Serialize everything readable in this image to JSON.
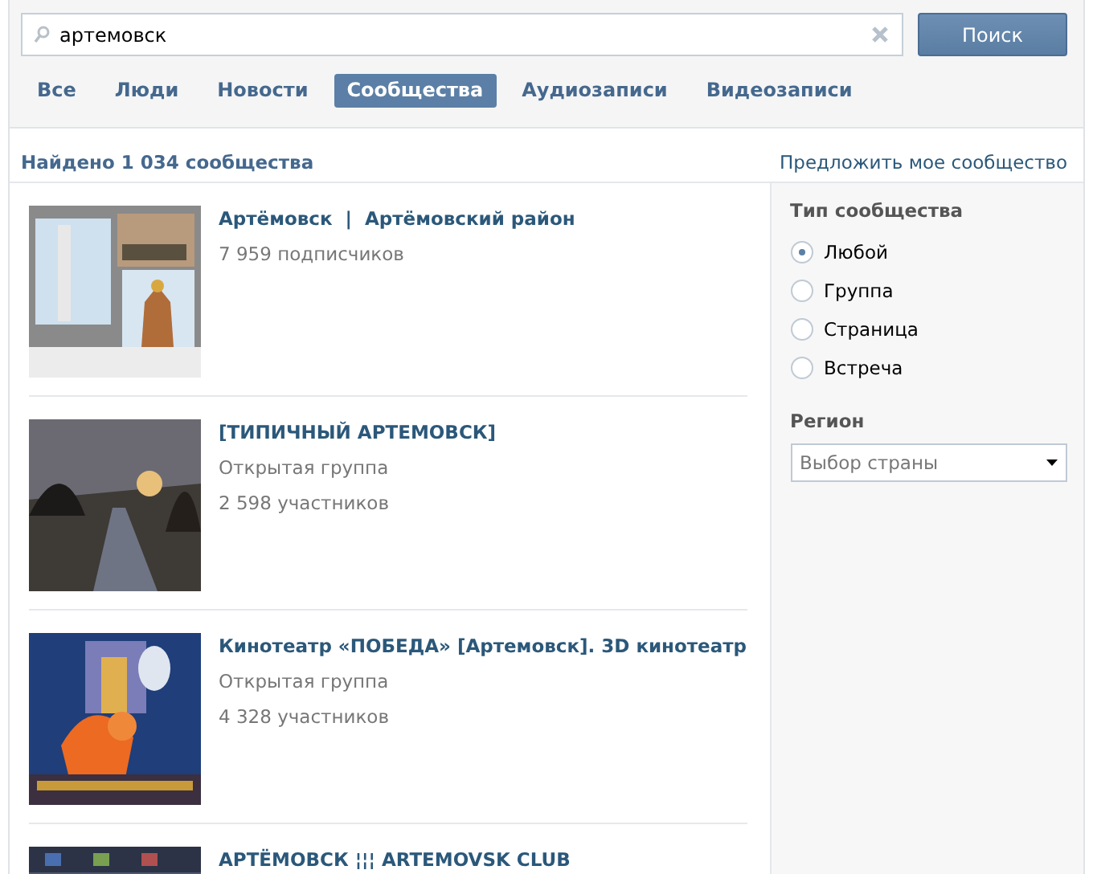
{
  "search": {
    "value": "артемовск",
    "button": "Поиск"
  },
  "tabs": [
    {
      "label": "Все",
      "selected": false
    },
    {
      "label": "Люди",
      "selected": false
    },
    {
      "label": "Новости",
      "selected": false
    },
    {
      "label": "Сообщества",
      "selected": true
    },
    {
      "label": "Аудиозаписи",
      "selected": false
    },
    {
      "label": "Видеозаписи",
      "selected": false
    }
  ],
  "summary": {
    "found": "Найдено 1 034 сообщества",
    "suggest_link": "Предложить мое сообщество"
  },
  "results": [
    {
      "title": "Артёмовск  |  Артёмовский район",
      "lines": [
        "7 959 подписчиков"
      ]
    },
    {
      "title": "[ТИПИЧНЫЙ АРТЕМОВСК]",
      "lines": [
        "Открытая группа",
        "2 598 участников"
      ]
    },
    {
      "title": "Кинотеатр «ПОБЕДА» [Артемовск]. 3D кинотеатр",
      "lines": [
        "Открытая группа",
        "4 328 участников"
      ]
    },
    {
      "title": "АРТЁМОВСК ¦¦¦ ARTEMOVSK CLUB"
    }
  ],
  "filters": {
    "type_heading": "Тип сообщества",
    "types": [
      {
        "label": "Любой",
        "selected": true
      },
      {
        "label": "Группа",
        "selected": false
      },
      {
        "label": "Страница",
        "selected": false
      },
      {
        "label": "Встреча",
        "selected": false
      }
    ],
    "region_heading": "Регион",
    "region_select": "Выбор страны"
  }
}
